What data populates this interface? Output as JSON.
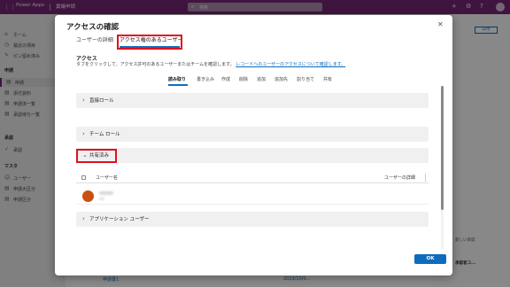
{
  "app": {
    "name": "Power Apps",
    "environment": "稟議申請",
    "search_placeholder": "検索"
  },
  "sidebar": {
    "items": [
      {
        "icon": "home-icon",
        "label": "ホーム"
      },
      {
        "icon": "recent-icon",
        "label": "最近の項目"
      },
      {
        "icon": "pin-icon",
        "label": "ピン留め済み"
      }
    ],
    "section1": "申請",
    "section1_items": [
      {
        "icon": "document-icon",
        "label": "申請"
      },
      {
        "icon": "document-icon",
        "label": "添付資料"
      },
      {
        "icon": "document-icon",
        "label": "申請済一覧"
      },
      {
        "icon": "document-icon",
        "label": "承認待ち一覧"
      }
    ],
    "section2": "承認",
    "section2_items": [
      {
        "icon": "check-icon",
        "label": "承認"
      }
    ],
    "section3": "マスタ",
    "section3_items": [
      {
        "icon": "person-icon",
        "label": "ユーザー"
      },
      {
        "icon": "document-icon",
        "label": "申請大区分"
      },
      {
        "icon": "document-icon",
        "label": "申請区分"
      }
    ]
  },
  "background": {
    "right_button": "日付",
    "right_label1": "新しい承認",
    "right_label2": "承認者コ...",
    "bottom_row_label": "申請書1",
    "bottom_row_date": "2023/10/0..."
  },
  "dialog": {
    "title": "アクセスの確認",
    "close_icon": "close-icon",
    "tabs": [
      "ユーザーの詳細",
      "アクセス権のあるユーザー"
    ],
    "active_tab": 1,
    "access_heading": "アクセス",
    "access_desc": "タブをクリックして、アクセス許可のあるユーザーまたはチームを確認します。",
    "access_link": "レコードへのユーザーのアクセスについて確認します。",
    "permission_tabs": [
      "読み取り",
      "書き込み",
      "作成",
      "削除",
      "追加",
      "追加先",
      "割り当て",
      "共有"
    ],
    "active_permission": 0,
    "sections": [
      {
        "label": "直接ロール",
        "expanded": false
      },
      {
        "label": "チーム ロール",
        "expanded": false
      },
      {
        "label": "共有済み",
        "expanded": true
      },
      {
        "label": "アプリケーション ユーザー",
        "expanded": false
      }
    ],
    "grid_headers": [
      "ユーザー名",
      "ユーザーの詳細"
    ],
    "ok_label": "OK"
  },
  "colors": {
    "topbar": "#742774",
    "accent": "#0f6cbd",
    "highlight": "#e0101e",
    "avatar": "#ca5010"
  }
}
